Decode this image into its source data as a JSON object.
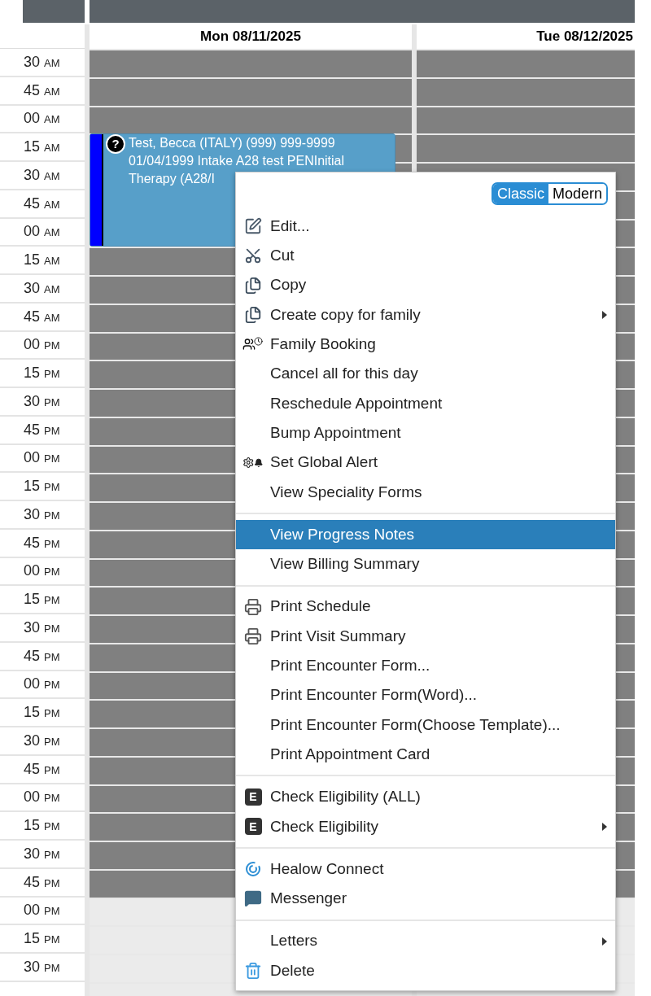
{
  "days": [
    {
      "label": "Mon 08/11/2025"
    },
    {
      "label": "Tue 08/12/2025"
    }
  ],
  "rows": [
    {
      "time": "30",
      "period": "AM",
      "open": false
    },
    {
      "time": "45",
      "period": "AM",
      "open": false
    },
    {
      "time": "00",
      "period": "AM",
      "open": false
    },
    {
      "time": "15",
      "period": "AM",
      "open": false
    },
    {
      "time": "30",
      "period": "AM",
      "open": false
    },
    {
      "time": "45",
      "period": "AM",
      "open": false
    },
    {
      "time": "00",
      "period": "AM",
      "open": false
    },
    {
      "time": "15",
      "period": "AM",
      "open": false
    },
    {
      "time": "30",
      "period": "AM",
      "open": false
    },
    {
      "time": "45",
      "period": "AM",
      "open": false
    },
    {
      "time": "00",
      "period": "PM",
      "open": false
    },
    {
      "time": "15",
      "period": "PM",
      "open": false
    },
    {
      "time": "30",
      "period": "PM",
      "open": false
    },
    {
      "time": "45",
      "period": "PM",
      "open": false
    },
    {
      "time": "00",
      "period": "PM",
      "open": false
    },
    {
      "time": "15",
      "period": "PM",
      "open": false
    },
    {
      "time": "30",
      "period": "PM",
      "open": false
    },
    {
      "time": "45",
      "period": "PM",
      "open": false
    },
    {
      "time": "00",
      "period": "PM",
      "open": false
    },
    {
      "time": "15",
      "period": "PM",
      "open": false
    },
    {
      "time": "30",
      "period": "PM",
      "open": false
    },
    {
      "time": "45",
      "period": "PM",
      "open": false
    },
    {
      "time": "00",
      "period": "PM",
      "open": false
    },
    {
      "time": "15",
      "period": "PM",
      "open": false
    },
    {
      "time": "30",
      "period": "PM",
      "open": false
    },
    {
      "time": "45",
      "period": "PM",
      "open": false
    },
    {
      "time": "00",
      "period": "PM",
      "open": false
    },
    {
      "time": "15",
      "period": "PM",
      "open": false
    },
    {
      "time": "30",
      "period": "PM",
      "open": false
    },
    {
      "time": "45",
      "period": "PM",
      "open": false
    },
    {
      "time": "00",
      "period": "PM",
      "open": true
    },
    {
      "time": "15",
      "period": "PM",
      "open": true
    },
    {
      "time": "30",
      "period": "PM",
      "open": true
    },
    {
      "open": true
    }
  ],
  "appointment": {
    "status_icon": "?",
    "lines": [
      "Test, Becca (ITALY) (999) 999-9999",
      "01/04/1999 Intake A28 test PENInitial",
      "Therapy (A28/I"
    ]
  },
  "context_menu": {
    "view_toggle": [
      {
        "label": "Classic",
        "selected": true
      },
      {
        "label": "Modern",
        "selected": false
      }
    ],
    "groups": [
      [
        {
          "label": "Edit...",
          "kind": "edit",
          "submenu": false,
          "selected": false
        },
        {
          "label": "Cut",
          "kind": "cut",
          "submenu": false,
          "selected": false
        },
        {
          "label": "Copy",
          "kind": "copy",
          "submenu": false,
          "selected": false
        },
        {
          "label": "Create copy for family",
          "kind": "copy",
          "submenu": true,
          "selected": false
        },
        {
          "label": "Family Booking",
          "kind": "family",
          "submenu": false,
          "selected": false
        },
        {
          "label": "Cancel all for this day",
          "submenu": false,
          "selected": false
        },
        {
          "label": "Reschedule Appointment",
          "submenu": false,
          "selected": false
        },
        {
          "label": "Bump Appointment",
          "submenu": false,
          "selected": false
        },
        {
          "label": "Set Global Alert",
          "kind": "alert",
          "submenu": false,
          "selected": false
        },
        {
          "label": "View Speciality Forms",
          "submenu": false,
          "selected": false
        }
      ],
      [
        {
          "label": "View Progress Notes",
          "submenu": false,
          "selected": true
        },
        {
          "label": "View Billing Summary",
          "submenu": false,
          "selected": false
        }
      ],
      [
        {
          "label": "Print Schedule",
          "kind": "print",
          "submenu": false,
          "selected": false
        },
        {
          "label": "Print Visit Summary",
          "kind": "print",
          "submenu": false,
          "selected": false
        },
        {
          "label": "Print Encounter Form...",
          "submenu": false,
          "selected": false
        },
        {
          "label": "Print Encounter Form(Word)...",
          "submenu": false,
          "selected": false
        },
        {
          "label": "Print Encounter Form(Choose Template)...",
          "submenu": false,
          "selected": false
        },
        {
          "label": "Print Appointment Card",
          "submenu": false,
          "selected": false
        }
      ],
      [
        {
          "label": "Check Eligibility (ALL)",
          "kind": "badge",
          "badge": "E",
          "submenu": false,
          "selected": false
        },
        {
          "label": "Check Eligibility",
          "kind": "badge",
          "badge": "E",
          "submenu": true,
          "selected": false
        }
      ],
      [
        {
          "label": "Healow Connect",
          "kind": "healow",
          "submenu": false,
          "selected": false
        },
        {
          "label": "Messenger",
          "kind": "message",
          "submenu": false,
          "selected": false
        }
      ],
      [
        {
          "label": "Letters",
          "submenu": true,
          "selected": false
        },
        {
          "label": "Delete",
          "kind": "delete",
          "submenu": false,
          "selected": false
        }
      ]
    ]
  }
}
